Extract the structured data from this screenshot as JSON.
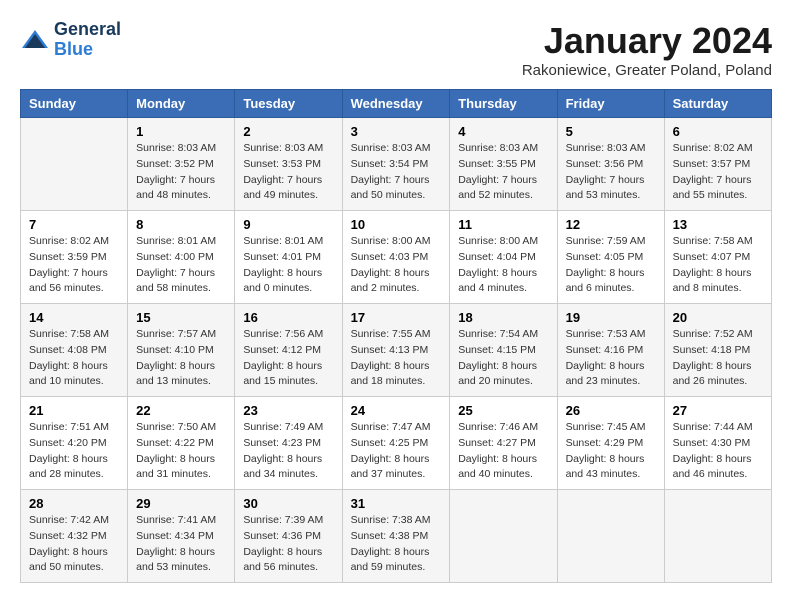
{
  "header": {
    "logo_line1": "General",
    "logo_line2": "Blue",
    "month": "January 2024",
    "location": "Rakoniewice, Greater Poland, Poland"
  },
  "weekdays": [
    "Sunday",
    "Monday",
    "Tuesday",
    "Wednesday",
    "Thursday",
    "Friday",
    "Saturday"
  ],
  "weeks": [
    [
      {
        "day": "",
        "info": ""
      },
      {
        "day": "1",
        "info": "Sunrise: 8:03 AM\nSunset: 3:52 PM\nDaylight: 7 hours\nand 48 minutes."
      },
      {
        "day": "2",
        "info": "Sunrise: 8:03 AM\nSunset: 3:53 PM\nDaylight: 7 hours\nand 49 minutes."
      },
      {
        "day": "3",
        "info": "Sunrise: 8:03 AM\nSunset: 3:54 PM\nDaylight: 7 hours\nand 50 minutes."
      },
      {
        "day": "4",
        "info": "Sunrise: 8:03 AM\nSunset: 3:55 PM\nDaylight: 7 hours\nand 52 minutes."
      },
      {
        "day": "5",
        "info": "Sunrise: 8:03 AM\nSunset: 3:56 PM\nDaylight: 7 hours\nand 53 minutes."
      },
      {
        "day": "6",
        "info": "Sunrise: 8:02 AM\nSunset: 3:57 PM\nDaylight: 7 hours\nand 55 minutes."
      }
    ],
    [
      {
        "day": "7",
        "info": "Sunrise: 8:02 AM\nSunset: 3:59 PM\nDaylight: 7 hours\nand 56 minutes."
      },
      {
        "day": "8",
        "info": "Sunrise: 8:01 AM\nSunset: 4:00 PM\nDaylight: 7 hours\nand 58 minutes."
      },
      {
        "day": "9",
        "info": "Sunrise: 8:01 AM\nSunset: 4:01 PM\nDaylight: 8 hours\nand 0 minutes."
      },
      {
        "day": "10",
        "info": "Sunrise: 8:00 AM\nSunset: 4:03 PM\nDaylight: 8 hours\nand 2 minutes."
      },
      {
        "day": "11",
        "info": "Sunrise: 8:00 AM\nSunset: 4:04 PM\nDaylight: 8 hours\nand 4 minutes."
      },
      {
        "day": "12",
        "info": "Sunrise: 7:59 AM\nSunset: 4:05 PM\nDaylight: 8 hours\nand 6 minutes."
      },
      {
        "day": "13",
        "info": "Sunrise: 7:58 AM\nSunset: 4:07 PM\nDaylight: 8 hours\nand 8 minutes."
      }
    ],
    [
      {
        "day": "14",
        "info": "Sunrise: 7:58 AM\nSunset: 4:08 PM\nDaylight: 8 hours\nand 10 minutes."
      },
      {
        "day": "15",
        "info": "Sunrise: 7:57 AM\nSunset: 4:10 PM\nDaylight: 8 hours\nand 13 minutes."
      },
      {
        "day": "16",
        "info": "Sunrise: 7:56 AM\nSunset: 4:12 PM\nDaylight: 8 hours\nand 15 minutes."
      },
      {
        "day": "17",
        "info": "Sunrise: 7:55 AM\nSunset: 4:13 PM\nDaylight: 8 hours\nand 18 minutes."
      },
      {
        "day": "18",
        "info": "Sunrise: 7:54 AM\nSunset: 4:15 PM\nDaylight: 8 hours\nand 20 minutes."
      },
      {
        "day": "19",
        "info": "Sunrise: 7:53 AM\nSunset: 4:16 PM\nDaylight: 8 hours\nand 23 minutes."
      },
      {
        "day": "20",
        "info": "Sunrise: 7:52 AM\nSunset: 4:18 PM\nDaylight: 8 hours\nand 26 minutes."
      }
    ],
    [
      {
        "day": "21",
        "info": "Sunrise: 7:51 AM\nSunset: 4:20 PM\nDaylight: 8 hours\nand 28 minutes."
      },
      {
        "day": "22",
        "info": "Sunrise: 7:50 AM\nSunset: 4:22 PM\nDaylight: 8 hours\nand 31 minutes."
      },
      {
        "day": "23",
        "info": "Sunrise: 7:49 AM\nSunset: 4:23 PM\nDaylight: 8 hours\nand 34 minutes."
      },
      {
        "day": "24",
        "info": "Sunrise: 7:47 AM\nSunset: 4:25 PM\nDaylight: 8 hours\nand 37 minutes."
      },
      {
        "day": "25",
        "info": "Sunrise: 7:46 AM\nSunset: 4:27 PM\nDaylight: 8 hours\nand 40 minutes."
      },
      {
        "day": "26",
        "info": "Sunrise: 7:45 AM\nSunset: 4:29 PM\nDaylight: 8 hours\nand 43 minutes."
      },
      {
        "day": "27",
        "info": "Sunrise: 7:44 AM\nSunset: 4:30 PM\nDaylight: 8 hours\nand 46 minutes."
      }
    ],
    [
      {
        "day": "28",
        "info": "Sunrise: 7:42 AM\nSunset: 4:32 PM\nDaylight: 8 hours\nand 50 minutes."
      },
      {
        "day": "29",
        "info": "Sunrise: 7:41 AM\nSunset: 4:34 PM\nDaylight: 8 hours\nand 53 minutes."
      },
      {
        "day": "30",
        "info": "Sunrise: 7:39 AM\nSunset: 4:36 PM\nDaylight: 8 hours\nand 56 minutes."
      },
      {
        "day": "31",
        "info": "Sunrise: 7:38 AM\nSunset: 4:38 PM\nDaylight: 8 hours\nand 59 minutes."
      },
      {
        "day": "",
        "info": ""
      },
      {
        "day": "",
        "info": ""
      },
      {
        "day": "",
        "info": ""
      }
    ]
  ]
}
